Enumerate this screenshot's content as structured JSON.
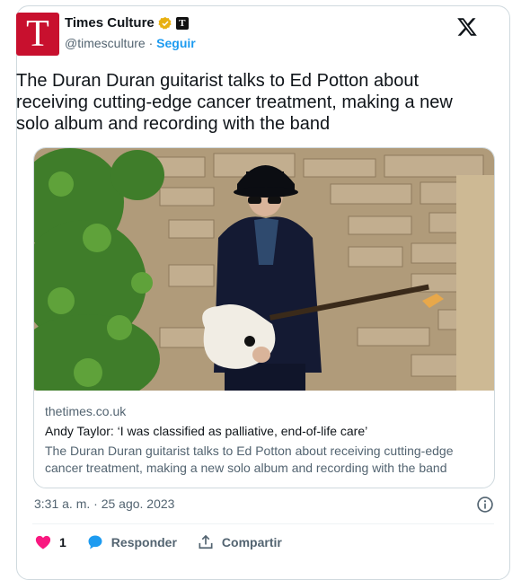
{
  "author": {
    "name": "Times Culture",
    "handle": "@timesculture",
    "separator": "·",
    "follow_label": "Seguir",
    "avatar_letter": "T",
    "affiliate_badge": "T",
    "avatar_color": "#c8102e",
    "verified_color": "#e8b00f"
  },
  "tweet": {
    "text": "The Duran Duran guitarist talks to Ed Potton about receiving cutting-edge cancer treatment, making a new solo album and recording with the band"
  },
  "link_card": {
    "domain": "thetimes.co.uk",
    "title": "Andy Taylor: ‘I was classified as palliative, end-of-life care’",
    "description": "The Duran Duran guitarist talks to Ed Potton about receiving cutting-edge cancer treatment, making a new solo album and recording with the band",
    "image_icon": "photo-guitarist-stone-wall"
  },
  "meta": {
    "timestamp": "3:31 a. m. · 25 ago. 2023"
  },
  "actions": {
    "like_count": "1",
    "reply_label": "Responder",
    "share_label": "Compartir",
    "like_color": "#f91880",
    "reply_color": "#1d9bf0"
  },
  "icons": {
    "close": "x-logo-icon",
    "info": "info-icon",
    "verified": "verified-badge-icon"
  }
}
